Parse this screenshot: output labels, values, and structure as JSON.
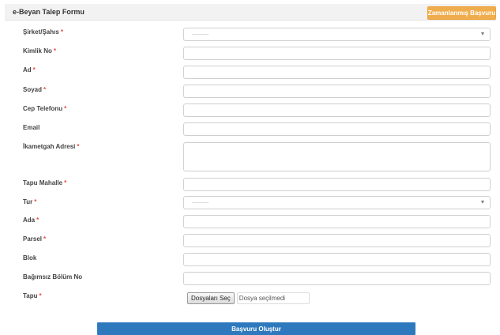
{
  "header": {
    "title": "e-Beyan Talep Formu",
    "action_button": "Zamanlanmış Başvuru"
  },
  "required_marker": "*",
  "form": {
    "sirket_sahis": {
      "label": "Şirket/Şahıs",
      "required": true,
      "value": "———"
    },
    "kimlik_no": {
      "label": "Kimlik No",
      "required": true,
      "value": ""
    },
    "ad": {
      "label": "Ad",
      "required": true,
      "value": ""
    },
    "soyad": {
      "label": "Soyad",
      "required": true,
      "value": ""
    },
    "cep_telefonu": {
      "label": "Cep Telefonu",
      "required": true,
      "value": ""
    },
    "email": {
      "label": "Email",
      "required": false,
      "value": ""
    },
    "ikametgah_adresi": {
      "label": "İkametgah Adresi",
      "required": true,
      "value": ""
    },
    "tapu_mahalle": {
      "label": "Tapu Mahalle",
      "required": true,
      "value": ""
    },
    "tur": {
      "label": "Tur",
      "required": true,
      "value": "———"
    },
    "ada": {
      "label": "Ada",
      "required": true,
      "value": ""
    },
    "parsel": {
      "label": "Parsel",
      "required": true,
      "value": ""
    },
    "blok": {
      "label": "Blok",
      "required": false,
      "value": ""
    },
    "bagimsiz_bolum_no": {
      "label": "Bağımsız Bölüm No",
      "required": false,
      "value": ""
    },
    "tapu": {
      "label": "Tapu",
      "required": true,
      "file_button": "Dosyaları Seç",
      "file_status": "Dosya seçilmedi"
    }
  },
  "submit_label": "Başvuru Oluştur",
  "colors": {
    "accent_orange": "#f0ad4e",
    "submit_blue": "#2e79be",
    "required_red": "#e74c3c"
  }
}
